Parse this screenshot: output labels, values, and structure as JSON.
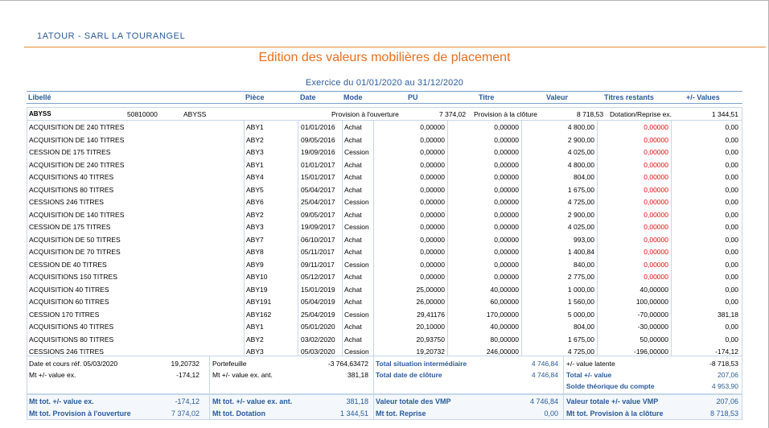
{
  "company": "1ATOUR - SARL LA TOURANGEL",
  "title": "Edition des valeurs mobilières de placement",
  "exercise": "Exercice du 01/01/2020 au 31/12/2020",
  "columns": {
    "libelle": "Libellé",
    "piece": "Pièce",
    "date": "Date",
    "mode": "Mode",
    "pu": "PU",
    "titre": "Titre",
    "valeur": "Valeur",
    "titres_restants": "Titres restants",
    "plus_values": "+/- Values"
  },
  "security": {
    "code": "ABYSS",
    "account": "50810000",
    "name": "ABYSS",
    "prov_open_label": "Provision à l'ouverture",
    "prov_open_value": "7 374,02",
    "prov_close_label": "Provision à la clôture",
    "prov_close_value": "8 718,53",
    "dotation_label": "Dotation/Reprise ex.",
    "dotation_value": "1 344,51"
  },
  "rows": [
    {
      "libelle": "ACQUISITION DE 240 TITRES",
      "piece": "ABY1",
      "date": "01/01/2016",
      "mode": "Achat",
      "pu": "0,00000",
      "titre": "0,00000",
      "valeur": "4 800,00",
      "restants": "0,00000",
      "pv": "0,00",
      "red": true
    },
    {
      "libelle": "ACQUISITION DE 140 TITRES",
      "piece": "ABY2",
      "date": "09/05/2016",
      "mode": "Achat",
      "pu": "0,00000",
      "titre": "0,00000",
      "valeur": "2 900,00",
      "restants": "0,00000",
      "pv": "0,00",
      "red": true
    },
    {
      "libelle": "CESSION DE 175 TITRES",
      "piece": "ABY3",
      "date": "19/09/2016",
      "mode": "Cession",
      "pu": "0,00000",
      "titre": "0,00000",
      "valeur": "4 025,00",
      "restants": "0,00000",
      "pv": "0,00",
      "red": true
    },
    {
      "libelle": "ACQUISITION DE 240 TITRES",
      "piece": "ABY1",
      "date": "01/01/2017",
      "mode": "Achat",
      "pu": "0,00000",
      "titre": "0,00000",
      "valeur": "4 800,00",
      "restants": "0,00000",
      "pv": "0,00",
      "red": true
    },
    {
      "libelle": "ACQUISITIONS 40 TITRES",
      "piece": "ABY4",
      "date": "15/01/2017",
      "mode": "Achat",
      "pu": "0,00000",
      "titre": "0,00000",
      "valeur": "804,00",
      "restants": "0,00000",
      "pv": "0,00",
      "red": true
    },
    {
      "libelle": "ACQUISITIONS 80 TITRES",
      "piece": "ABY5",
      "date": "05/04/2017",
      "mode": "Achat",
      "pu": "0,00000",
      "titre": "0,00000",
      "valeur": "1 675,00",
      "restants": "0,00000",
      "pv": "0,00",
      "red": true
    },
    {
      "libelle": "CESSIONS 246 TITRES",
      "piece": "ABY6",
      "date": "25/04/2017",
      "mode": "Cession",
      "pu": "0,00000",
      "titre": "0,00000",
      "valeur": "4 725,00",
      "restants": "0,00000",
      "pv": "0,00",
      "red": true
    },
    {
      "libelle": "ACQUISITION DE 140 TITRES",
      "piece": "ABY2",
      "date": "09/05/2017",
      "mode": "Achat",
      "pu": "0,00000",
      "titre": "0,00000",
      "valeur": "2 900,00",
      "restants": "0,00000",
      "pv": "0,00",
      "red": true
    },
    {
      "libelle": "CESSION DE 175 TITRES",
      "piece": "ABY3",
      "date": "19/09/2017",
      "mode": "Cession",
      "pu": "0,00000",
      "titre": "0,00000",
      "valeur": "4 025,00",
      "restants": "0,00000",
      "pv": "0,00",
      "red": true
    },
    {
      "libelle": "ACQUISITION DE 50 TITRES",
      "piece": "ABY7",
      "date": "06/10/2017",
      "mode": "Achat",
      "pu": "0,00000",
      "titre": "0,00000",
      "valeur": "993,00",
      "restants": "0,00000",
      "pv": "0,00",
      "red": true
    },
    {
      "libelle": "ACQUISITION DE 70 TITRES",
      "piece": "ABY8",
      "date": "05/11/2017",
      "mode": "Achat",
      "pu": "0,00000",
      "titre": "0,00000",
      "valeur": "1 400,84",
      "restants": "0,00000",
      "pv": "0,00",
      "red": true
    },
    {
      "libelle": "CESSION DE 40 TITRES",
      "piece": "ABY9",
      "date": "09/11/2017",
      "mode": "Cession",
      "pu": "0,00000",
      "titre": "0,00000",
      "valeur": "840,00",
      "restants": "0,00000",
      "pv": "0,00",
      "red": true
    },
    {
      "libelle": "ACQUISITIONS 150 TITRES",
      "piece": "ABY10",
      "date": "05/12/2017",
      "mode": "Achat",
      "pu": "0,00000",
      "titre": "0,00000",
      "valeur": "2 775,00",
      "restants": "0,00000",
      "pv": "0,00",
      "red": true
    },
    {
      "libelle": "ACQUISITION 40 TITRES",
      "piece": "ABY19",
      "date": "15/01/2019",
      "mode": "Achat",
      "pu": "25,00000",
      "titre": "40,00000",
      "valeur": "1 000,00",
      "restants": "40,00000",
      "pv": "0,00",
      "red": false
    },
    {
      "libelle": "ACQUISITION 60 TITRES",
      "piece": "ABY191",
      "date": "05/04/2019",
      "mode": "Achat",
      "pu": "26,00000",
      "titre": "60,00000",
      "valeur": "1 560,00",
      "restants": "100,00000",
      "pv": "0,00",
      "red": false
    },
    {
      "libelle": "CESSION 170 TITRES",
      "piece": "ABY162",
      "date": "25/04/2019",
      "mode": "Cession",
      "pu": "29,41176",
      "titre": "170,00000",
      "valeur": "5 000,00",
      "restants": "-70,00000",
      "pv": "381,18",
      "red": false
    },
    {
      "libelle": "ACQUISITIONS 40 TITRES",
      "piece": "ABY1",
      "date": "05/01/2020",
      "mode": "Achat",
      "pu": "20,10000",
      "titre": "40,00000",
      "valeur": "804,00",
      "restants": "-30,00000",
      "pv": "0,00",
      "red": false
    },
    {
      "libelle": "ACQUISITIONS 80 TITRES",
      "piece": "ABY2",
      "date": "03/02/2020",
      "mode": "Achat",
      "pu": "20,93750",
      "titre": "80,00000",
      "valeur": "1 675,00",
      "restants": "50,00000",
      "pv": "0,00",
      "red": false
    },
    {
      "libelle": "CESSIONS 246 TITRES",
      "piece": "ABY3",
      "date": "05/03/2020",
      "mode": "Cession",
      "pu": "19,20732",
      "titre": "246,00000",
      "valeur": "4 725,00",
      "restants": "-196,00000",
      "pv": "-174,12",
      "red": false
    }
  ],
  "summary": {
    "date_cours_label": "Date et cours réf. 05/03/2020",
    "date_cours_value": "19,20732",
    "mt_pv_label": "Mt +/- value ex.",
    "mt_pv_value": "-174,12",
    "portefeuille_label": "Portefeuille",
    "portefeuille_value": "-3 764,63472",
    "mt_pv_ant_label": "Mt +/- value ex. ant.",
    "mt_pv_ant_value": "381,18",
    "total_sit_label": "Total situation intermédiaire",
    "total_sit_value": "4 746,84",
    "total_cloture_label": "Total date de clôture",
    "total_cloture_value": "4 746,84",
    "latente_label": "+/- value latente",
    "latente_value": "-8 718,53",
    "total_pv_label": "Total +/- value",
    "total_pv_value": "207,06",
    "solde_label": "Solde théorique du compte",
    "solde_value": "4 953,90"
  },
  "footer": {
    "mt_tot_pv_label": "Mt tot. +/- value ex.",
    "mt_tot_pv_value": "-174,12",
    "mt_tot_prov_label": "Mt tot. Provision à l'ouverture",
    "mt_tot_prov_value": "7 374,02",
    "mt_tot_pv_ant_label": "Mt tot. +/- value ex. ant.",
    "mt_tot_pv_ant_value": "381,18",
    "mt_tot_dot_label": "Mt tot. Dotation",
    "mt_tot_dot_value": "1 344,51",
    "valeur_vmp_label": "Valeur totale des VMP",
    "valeur_vmp_value": "4 746,84",
    "mt_tot_reprise_label": "Mt tot. Reprise",
    "mt_tot_reprise_value": "0,00",
    "valeur_pv_vmp_label": "Valeur totale +/- value VMP",
    "valeur_pv_vmp_value": "207,06",
    "mt_tot_prov_close_label": "Mt tot. Provision à la clôture",
    "mt_tot_prov_close_value": "8 718,53"
  }
}
